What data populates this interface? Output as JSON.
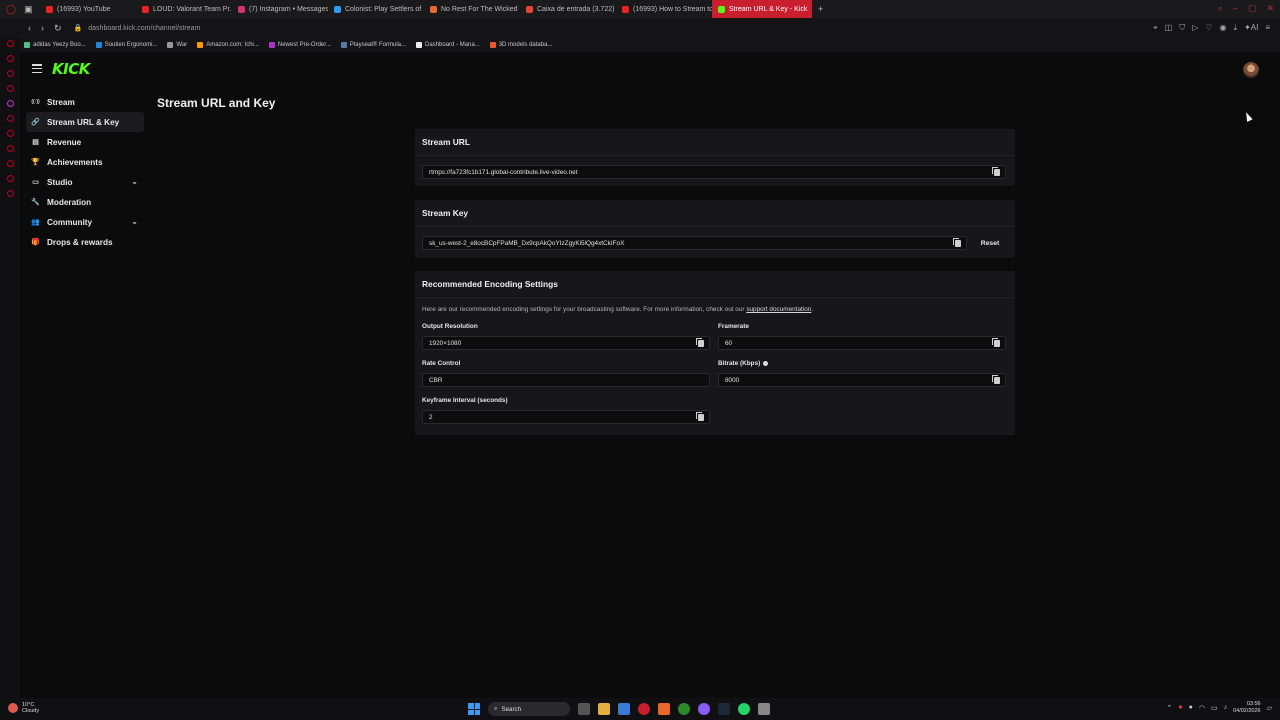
{
  "browser": {
    "tabs": [
      {
        "label": "(16993) YouTube",
        "color": "#e22"
      },
      {
        "label": "LOUD: Valorant Team Pr...",
        "color": "#e22"
      },
      {
        "label": "(7) Instagram • Messages",
        "color": "#d6336c"
      },
      {
        "label": "Colonist: Play Settlers of ...",
        "color": "#2a9df4"
      },
      {
        "label": "No Rest For The Wicked ...",
        "color": "#e8692b"
      },
      {
        "label": "Caixa de entrada (3.722)",
        "color": "#ea4335"
      },
      {
        "label": "(16993) How to Stream to...",
        "color": "#e22"
      },
      {
        "label": "Stream URL & Key - Kick",
        "color": "#53fc18",
        "active": true
      }
    ],
    "new_tab": "+",
    "url": "dashboard.kick.com/channel/stream",
    "bookmarks": [
      {
        "label": "adidas Yeezy Boo...",
        "color": "#5b8"
      },
      {
        "label": "Soutien Ergonomi...",
        "color": "#28d"
      },
      {
        "label": "War",
        "color": "#999"
      },
      {
        "label": "Amazon.com: Ichi...",
        "color": "#f90"
      },
      {
        "label": "Newest Pre-Order...",
        "color": "#a3c"
      },
      {
        "label": "Playseat® Formula...",
        "color": "#57a"
      },
      {
        "label": "Dashboard - Mana...",
        "color": "#eee"
      },
      {
        "label": "3D models databa...",
        "color": "#e53"
      }
    ]
  },
  "kick": {
    "logo": "KICK"
  },
  "sidebar": {
    "items": [
      {
        "label": "Stream",
        "icon": "stream-icon",
        "glyph": "((·))",
        "active": false,
        "chevron": false
      },
      {
        "label": "Stream URL & Key",
        "icon": "link-icon",
        "glyph": "🔗",
        "active": true,
        "chevron": false
      },
      {
        "label": "Revenue",
        "icon": "chart-icon",
        "glyph": "▤",
        "active": false,
        "chevron": false
      },
      {
        "label": "Achievements",
        "icon": "trophy-icon",
        "glyph": "🏆",
        "active": false,
        "chevron": false
      },
      {
        "label": "Studio",
        "icon": "studio-icon",
        "glyph": "▭",
        "active": false,
        "chevron": true
      },
      {
        "label": "Moderation",
        "icon": "wrench-icon",
        "glyph": "🔧",
        "active": false,
        "chevron": false
      },
      {
        "label": "Community",
        "icon": "community-icon",
        "glyph": "👥",
        "active": false,
        "chevron": true
      },
      {
        "label": "Drops & rewards",
        "icon": "gift-icon",
        "glyph": "🎁",
        "active": false,
        "chevron": false
      }
    ]
  },
  "page": {
    "title": "Stream URL and Key"
  },
  "stream_url": {
    "title": "Stream URL",
    "value": "rtmps://fa723fc1b171.global-contribute.live-video.net"
  },
  "stream_key": {
    "title": "Stream Key",
    "value": "sk_us-west-2_e8ocBCpFPaMB_Dx9cpAkQoYIzZgyKi5iQg4xtCkIFoX",
    "reset_label": "Reset"
  },
  "encoding": {
    "title": "Recommended Encoding Settings",
    "description": "Here are our recommended encoding settings for your broadcasting software. For more information, check out our",
    "link_label": "support documentation",
    "link_suffix": ".",
    "output_resolution": {
      "label": "Output Resolution",
      "value": "1920×1080"
    },
    "framerate": {
      "label": "Framerate",
      "value": "60"
    },
    "rate_control": {
      "label": "Rate Control",
      "value": "CBR"
    },
    "bitrate": {
      "label": "Bitrate (Kbps)",
      "value": "8000"
    },
    "keyframe": {
      "label": "Keyframe Interval (seconds)",
      "value": "2"
    }
  },
  "taskbar": {
    "weather_temp": "10°C",
    "weather_desc": "Cloudy",
    "search_label": "Search",
    "time": "03:56",
    "date": "04/02/2026"
  }
}
